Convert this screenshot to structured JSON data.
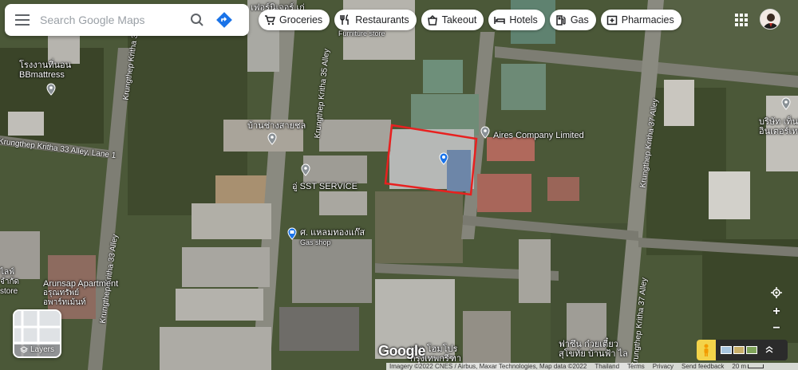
{
  "search": {
    "placeholder": "Search Google Maps"
  },
  "chips": [
    {
      "label": "Groceries",
      "icon": "cart-icon"
    },
    {
      "label": "Restaurants",
      "icon": "fork-knife-icon"
    },
    {
      "label": "Takeout",
      "icon": "takeout-bag-icon"
    },
    {
      "label": "Hotels",
      "icon": "bed-icon"
    },
    {
      "label": "Gas",
      "icon": "gas-pump-icon"
    },
    {
      "label": "Pharmacies",
      "icon": "pharmacy-icon"
    }
  ],
  "places": {
    "bbmattress": "โรงงานที่นอน\nBBmattress",
    "aires": "Aires Company Limited",
    "ban_chang": "บ้านช่างสายชล",
    "sst": "อู่ SST SERVICE",
    "gas_shop_th": "ศ. แหลมทองแก๊ส",
    "gas_shop": "Gas shop",
    "arunsap": "Arunsap Apartment",
    "arunsap_th": "อรุณทรัพย์\nอพาร์ทเม้นท์",
    "furniture_th": "เฟอร์นิเจอร์ เก่",
    "furniture": "Furniture store",
    "company_th": "บริษัท เท็นมิลเลี่ยน\nอินเตอร์เทรดดิ้ง",
    "lifestyle": "ไลฟ์\nจำกัด\nstore",
    "bottom_right_th": "ฟาซึน ก๋วยเตี๋ยว\nสุโขทัย บ้านฟ้า ไล",
    "bottom_mid_th": "เดล โฮมโปร\nกรุงเทพกรีฑา"
  },
  "roads": {
    "kritha35": "Krungthep Kritha 35 Alley",
    "kritha33_lane1": "Krungthep Kritha 33 Alley, Lane 1",
    "kritha33": "Krungthep Kritha 33 Alley",
    "kritha37_top": "Krungthep Kritha 37 Alley",
    "kritha37_bottom": "Krungthep Kritha 37 Alley"
  },
  "controls": {
    "layers_label": "Layers",
    "zoom_in": "+",
    "zoom_out": "−"
  },
  "footer": {
    "logo": "Google",
    "imagery": "Imagery ©2022 CNES / Airbus, Maxar Technologies, Map data ©2022",
    "country": "Thailand",
    "terms": "Terms",
    "privacy": "Privacy",
    "feedback": "Send feedback",
    "scale": "20 m"
  },
  "colors": {
    "highlight": "#e8201f",
    "pin_blue": "#1a73e8",
    "pin_gray": "#8a9196",
    "directions": "#1a73e8"
  }
}
